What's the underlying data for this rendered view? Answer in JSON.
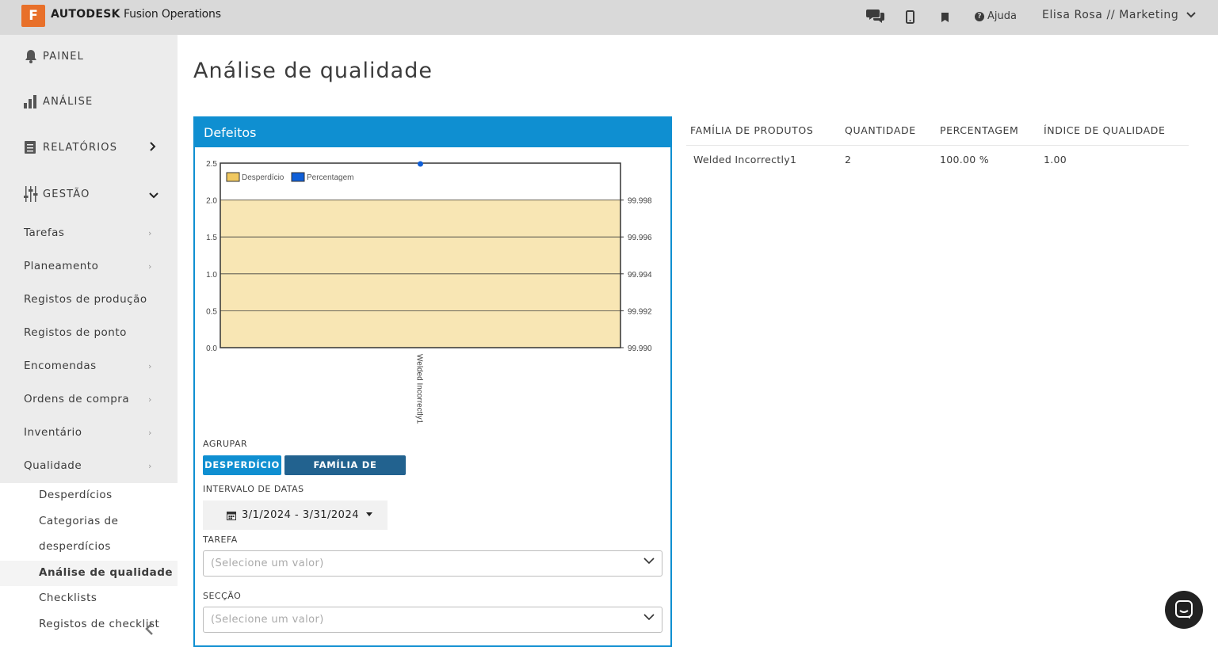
{
  "header": {
    "logo_letter": "F",
    "brand_bold": "AUTODESK",
    "brand_rest": "Fusion Operations",
    "help_label": "Ajuda",
    "user_label": "Elisa Rosa // Marketing"
  },
  "sidebar": {
    "main": [
      {
        "label": "PAINEL"
      },
      {
        "label": "ANÁLISE"
      },
      {
        "label": "RELATÓRIOS"
      },
      {
        "label": "GESTÃO"
      }
    ],
    "items": [
      {
        "label": "Tarefas"
      },
      {
        "label": "Planeamento"
      },
      {
        "label": "Registos de produção"
      },
      {
        "label": "Registos de ponto"
      },
      {
        "label": "Encomendas"
      },
      {
        "label": "Ordens de compra"
      },
      {
        "label": "Inventário"
      },
      {
        "label": "Qualidade"
      }
    ],
    "sub_items": [
      {
        "label": "Desperdícios"
      },
      {
        "label": "Categorias de"
      },
      {
        "label": "desperdícios"
      },
      {
        "label": "Análise de qualidade"
      },
      {
        "label": "Checklists"
      },
      {
        "label": "Registos de checklist"
      }
    ]
  },
  "page": {
    "title": "Análise de qualidade"
  },
  "panel": {
    "title": "Defeitos",
    "group_label": "AGRUPAR",
    "group_buttons": [
      "DESPERDÍCIO",
      "FAMÍLIA DE PRODUTOS"
    ],
    "date_label": "INTERVALO DE DATAS",
    "date_value": "3/1/2024 - 3/31/2024",
    "task_label": "TAREFA",
    "task_placeholder": "(Selecione um valor)",
    "section_label": "SECÇÃO",
    "section_placeholder": "(Selecione um valor)"
  },
  "chart_data": {
    "type": "bar",
    "categories": [
      "Welded Incorrectly1"
    ],
    "series": [
      {
        "name": "Desperdício",
        "values": [
          2
        ],
        "axis": "left",
        "color": "#f8e6b4"
      },
      {
        "name": "Percentagem",
        "values": [
          100
        ],
        "axis": "right",
        "color": "#0f5fd8"
      }
    ],
    "legend": "top-left",
    "y_left_ticks": [
      "0.0",
      "0.5",
      "1.0",
      "1.5",
      "2.0",
      "2.5"
    ],
    "y_right_ticks": [
      "99.990",
      "99.992",
      "99.994",
      "99.996",
      "99.998"
    ],
    "ylim_left": [
      0,
      2.5
    ],
    "grid": true
  },
  "table": {
    "headers": [
      "FAMÍLIA DE PRODUTOS",
      "QUANTIDADE",
      "PERCENTAGEM",
      "ÍNDICE DE QUALIDADE"
    ],
    "rows": [
      [
        "Welded Incorrectly1",
        "2",
        "100.00 %",
        "1.00"
      ]
    ]
  },
  "colors": {
    "accent": "#0f8fd1",
    "accent_dark": "#22628f",
    "logo": "#e8702a"
  }
}
